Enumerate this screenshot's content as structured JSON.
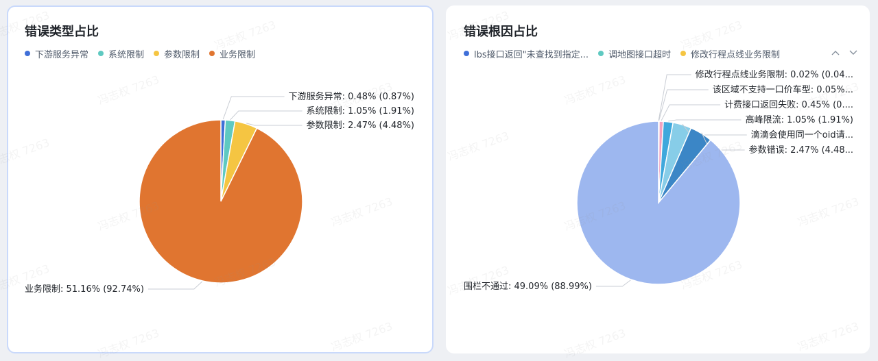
{
  "watermark": "冯志权 7263",
  "charts": [
    {
      "title": "错误类型占比",
      "legend": [
        {
          "label": "下游服务异常",
          "color": "#3f6fd8"
        },
        {
          "label": "系统限制",
          "color": "#5fc9c1"
        },
        {
          "label": "参数限制",
          "color": "#f5c542"
        },
        {
          "label": "业务限制",
          "color": "#e07530"
        }
      ]
    },
    {
      "title": "错误根因占比",
      "legend": [
        {
          "label": "lbs接口返回\"未查找到指定...",
          "color": "#3f6fd8"
        },
        {
          "label": "调地图接口超时",
          "color": "#5fc9c1"
        },
        {
          "label": "修改行程点线业务限制",
          "color": "#f5c542"
        }
      ],
      "pager": {
        "up": "^",
        "down": "v"
      }
    }
  ],
  "chart_data": [
    {
      "type": "pie",
      "title": "错误类型占比",
      "slices": [
        {
          "name": "下游服务异常",
          "label": "下游服务异常: 0.48% (0.87%)",
          "percent": 0.87,
          "color": "#3f6fd8"
        },
        {
          "name": "系统限制",
          "label": "系统限制: 1.05% (1.91%)",
          "percent": 1.91,
          "color": "#5fc9c1"
        },
        {
          "name": "参数限制",
          "label": "参数限制: 2.47% (4.48%)",
          "percent": 4.48,
          "color": "#f5c542"
        },
        {
          "name": "业务限制",
          "label": "业务限制: 51.16% (92.74%)",
          "percent": 92.74,
          "color": "#e07530"
        }
      ]
    },
    {
      "type": "pie",
      "title": "错误根因占比",
      "slices": [
        {
          "name": "修改行程点线业务限制",
          "label": "修改行程点线业务限制: 0.02% (0.04...",
          "percent": 0.04,
          "color": "#e8b3c9"
        },
        {
          "name": "该区域不支持一口价车型",
          "label": "该区域不支持一口价车型: 0.05%...",
          "percent": 0.09,
          "color": "#c7b6e6"
        },
        {
          "name": "计费接口返回失败",
          "label": "计费接口返回失败: 0.45% (0....",
          "percent": 0.82,
          "color": "#f2a2c0"
        },
        {
          "name": "高峰限流",
          "label": "高峰限流: 1.05% (1.91%)",
          "percent": 1.91,
          "color": "#3fa8dc"
        },
        {
          "name": "滴滴会使用同一个oid请...",
          "label": "滴滴会使用同一个oid请...",
          "percent": 3.67,
          "color": "#87cde8"
        },
        {
          "name": "参数错误",
          "label": "参数错误: 2.47% (4.48...",
          "percent": 4.48,
          "color": "#3b86c6"
        },
        {
          "name": "围栏不通过",
          "label": "围栏不通过: 49.09% (88.99%)",
          "percent": 88.99,
          "color": "#9db7ef"
        }
      ]
    }
  ]
}
